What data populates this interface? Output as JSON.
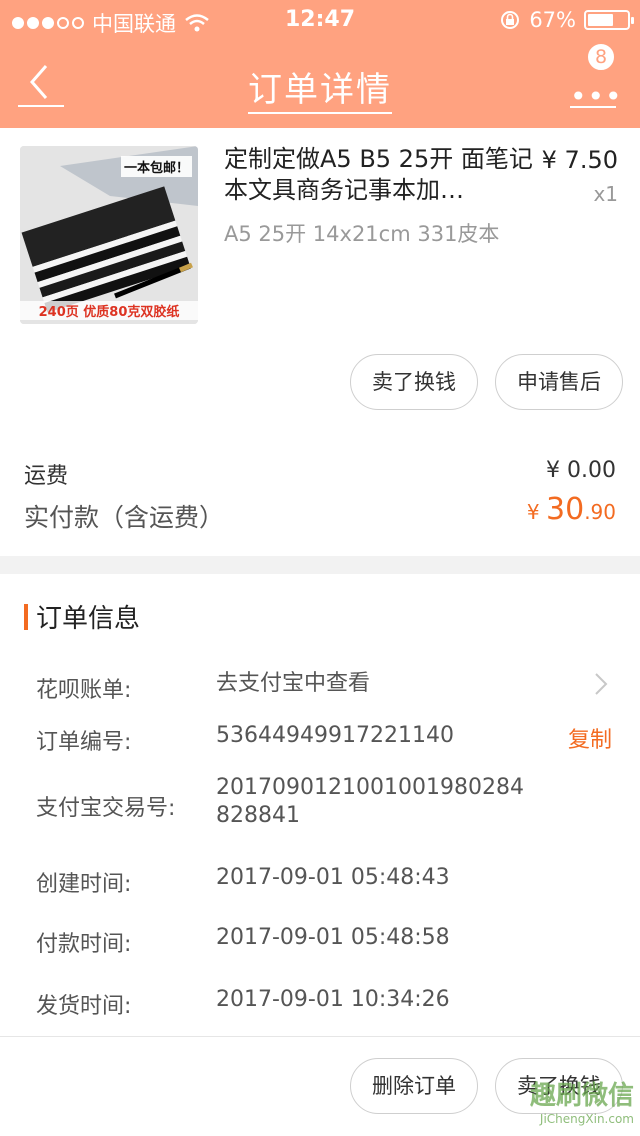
{
  "status_bar": {
    "carrier": "中国联通",
    "time": "12:47",
    "battery": "67%",
    "battery_level": 0.67,
    "signal_bars_filled": 3
  },
  "nav": {
    "title": "订单详情",
    "badge_count": "8"
  },
  "product": {
    "title": "定制定做A5 B5 25开 面笔记本文具商务记事本加…",
    "price": "¥ 7.50",
    "quantity": "x1",
    "spec": "A5 25开 14x21cm 331皮本",
    "thumb_tag": "一本包邮！",
    "thumb_caption": "240页 优质80克双胶纸",
    "actions": [
      "卖了换钱",
      "申请售后"
    ]
  },
  "summary": {
    "shipping_label": "运费",
    "shipping_value": "¥ 0.00",
    "paid_label": "实付款（含运费）",
    "paid_symbol": "¥ ",
    "paid_int": "30",
    "paid_decimal": ".90"
  },
  "order_info": {
    "title": "订单信息",
    "rows": [
      {
        "label": "花呗账单:",
        "value": "去支付宝中查看"
      },
      {
        "label": "订单编号:",
        "value": "53644949917221140"
      },
      {
        "label": "支付宝交易号:",
        "value": "2017090121001001980284",
        "value2": "828841"
      },
      {
        "label": "创建时间:",
        "value": "2017-09-01 05:48:43"
      },
      {
        "label": "付款时间:",
        "value": "2017-09-01 05:48:58"
      },
      {
        "label": "发货时间:",
        "value": "2017-09-01 10:34:26"
      }
    ],
    "copy_label": "复制"
  },
  "footer_actions": [
    "删除订单",
    "卖了换钱"
  ],
  "watermark": {
    "main": "趣刷微信",
    "sub": "JiChengXin.com"
  },
  "colors": {
    "header": "#ffa280",
    "accent": "#f36b21",
    "band": "#f2f2f2"
  },
  "icons": [
    "wifi-icon",
    "rotation-lock-icon",
    "back-arrow-icon",
    "more-icon",
    "chevron-right-icon"
  ]
}
